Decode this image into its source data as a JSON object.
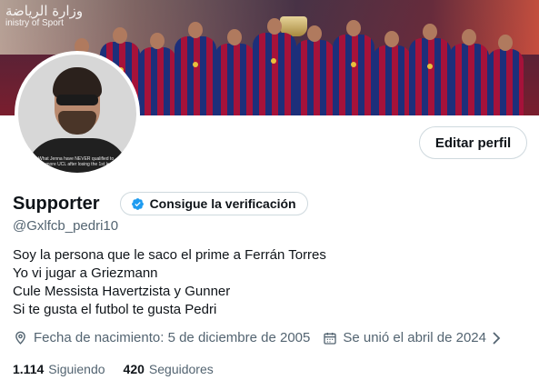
{
  "banner": {
    "overlay_line1": "وزارة الرياضة",
    "overlay_line2": "inistry of Sport"
  },
  "avatar": {
    "shirt_caption": "What Jenna have NEVER qualified to the more UCL after losing the 1st leg"
  },
  "profile": {
    "edit_label": "Editar perfil",
    "display_name": "Supporter",
    "verify_label": "Consigue la verificación",
    "handle": "@Gxlfcb_pedri10"
  },
  "bio": {
    "lines": [
      "Soy la persona que le saco el prime a Ferrán Torres",
      "Yo vi jugar a Griezmann",
      "Cule Messista Havertzista y Gunner",
      "Si te gusta el futbol te gusta Pedri"
    ]
  },
  "meta": {
    "birth": "Fecha de nacimiento: 5 de diciembre de 2005",
    "joined": "Se unió el abril de 2024"
  },
  "stats": {
    "following_count": "1.114",
    "following_label": "Siguiendo",
    "followers_count": "420",
    "followers_label": "Seguidores"
  },
  "icons": {
    "verify": "verified-badge-icon",
    "birth": "location-pin-icon",
    "joined": "calendar-icon",
    "chevron": "chevron-right-icon"
  },
  "colors": {
    "accent": "#1d9bf0",
    "text_primary": "#0f1419",
    "text_secondary": "#536471",
    "border": "#cfd9de"
  }
}
